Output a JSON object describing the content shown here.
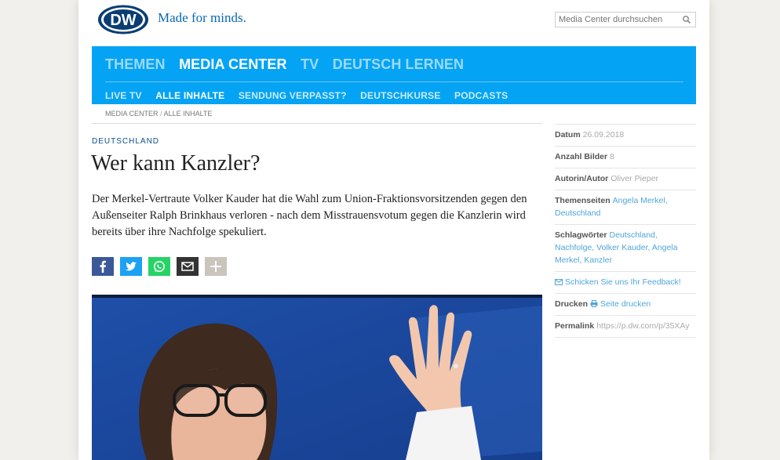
{
  "header": {
    "logo_text": "DW",
    "slogan": "Made for minds.",
    "search_placeholder": "Media Center durchsuchen"
  },
  "nav": {
    "main": [
      "THEMEN",
      "MEDIA CENTER",
      "TV",
      "DEUTSCH LERNEN"
    ],
    "main_active": "MEDIA CENTER",
    "sub": [
      "LIVE TV",
      "ALLE INHALTE",
      "SENDUNG VERPASST?",
      "DEUTSCHKURSE",
      "PODCASTS"
    ],
    "sub_active": "ALLE INHALTE"
  },
  "breadcrumb": {
    "item1": "MEDIA CENTER",
    "separator": "/",
    "item2": "ALLE INHALTE"
  },
  "article": {
    "kicker": "DEUTSCHLAND",
    "title": "Wer kann Kanzler?",
    "teaser": "Der Merkel-Vertraute Volker Kauder hat die Wahl zum Union-Fraktionsvorsitzenden gegen den Außenseiter Ralph Brinkhaus verloren - nach dem Misstrauensvotum gegen die Kanzlerin wird bereits über ihre Nachfolge spekuliert."
  },
  "share": [
    {
      "name": "facebook-icon",
      "color": "#3b5998"
    },
    {
      "name": "twitter-icon",
      "color": "#1da1f2"
    },
    {
      "name": "whatsapp-icon",
      "color": "#25d366"
    },
    {
      "name": "email-icon",
      "color": "#333333"
    },
    {
      "name": "plus-icon",
      "color": "#c9c4bc"
    }
  ],
  "sidebar": {
    "datum_label": "Datum",
    "datum_value": "26.09.2018",
    "bilder_label": "Anzahl Bilder",
    "bilder_value": "8",
    "autor_label": "Autorin/Autor",
    "autor_value": "Oliver Pieper",
    "themen_label": "Themenseiten",
    "themen_links": [
      "Angela Merkel",
      "Deutschland"
    ],
    "schlag_label": "Schlagwörter",
    "schlag_links": [
      "Deutschland",
      "Nachfolge",
      "Volker Kauder",
      "Angela Merkel",
      "Kanzler"
    ],
    "feedback_text": "Schicken Sie uns Ihr Feedback!",
    "drucken_label": "Drucken",
    "drucken_link": "Seite drucken",
    "permalink_label": "Permalink",
    "permalink_value": "https://p.dw.com/p/35XAy"
  },
  "colors": {
    "nav_bg": "#05a3f4",
    "dw_blue": "#0a68b4",
    "link": "#4fa6d9"
  }
}
